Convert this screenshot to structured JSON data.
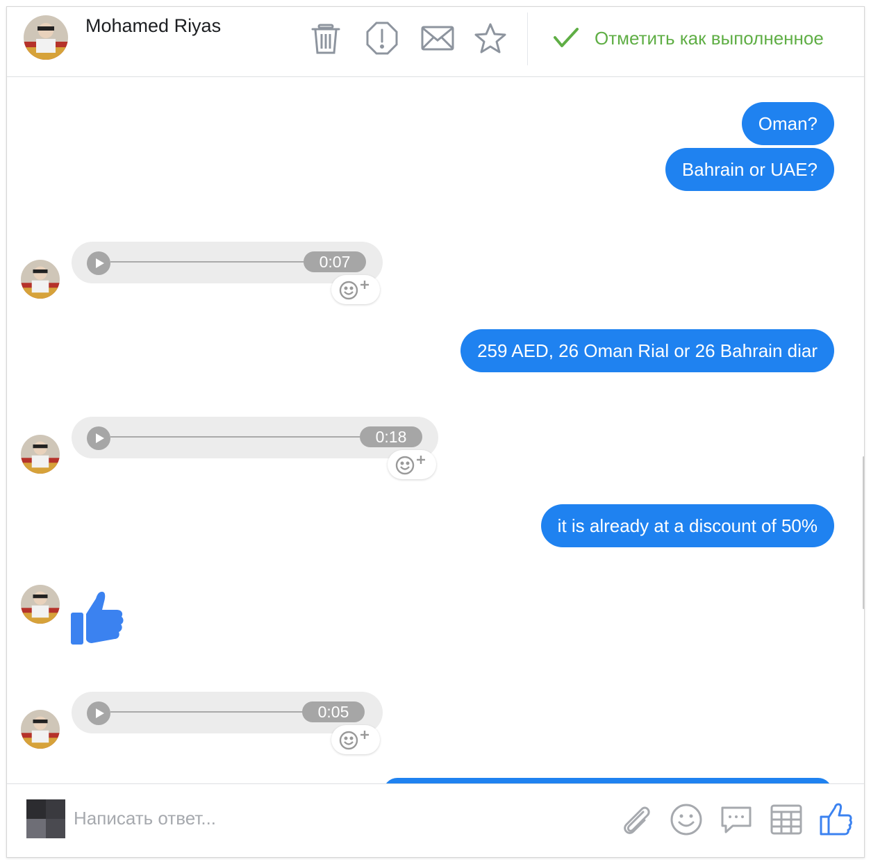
{
  "header": {
    "contact_name": "Mohamed Riyas",
    "mark_done_label": "Отметить как выполненное",
    "icons": [
      "trash-icon",
      "report-icon",
      "mail-icon",
      "star-icon",
      "check-icon"
    ]
  },
  "messages": [
    {
      "type": "outgoing_text",
      "text": "Oman?"
    },
    {
      "type": "outgoing_text",
      "text": "Bahrain or UAE?"
    },
    {
      "type": "incoming_audio",
      "duration": "0:07"
    },
    {
      "type": "outgoing_text",
      "text": "259 AED, 26 Oman Rial or 26 Bahrain diar"
    },
    {
      "type": "incoming_audio",
      "duration": "0:18"
    },
    {
      "type": "outgoing_text",
      "text": "it is already at a discount of 50%"
    },
    {
      "type": "incoming_like"
    },
    {
      "type": "incoming_audio",
      "duration": "0:05"
    }
  ],
  "composer": {
    "placeholder": "Написать ответ...",
    "icons": [
      "attach-icon",
      "emoji-icon",
      "chat-icon",
      "template-icon",
      "like-icon"
    ]
  },
  "colors": {
    "outgoing_bubble": "#1f82f0",
    "mark_done": "#5fae45",
    "like_blue": "#3b82f0",
    "audio_bubble": "#ececec"
  }
}
